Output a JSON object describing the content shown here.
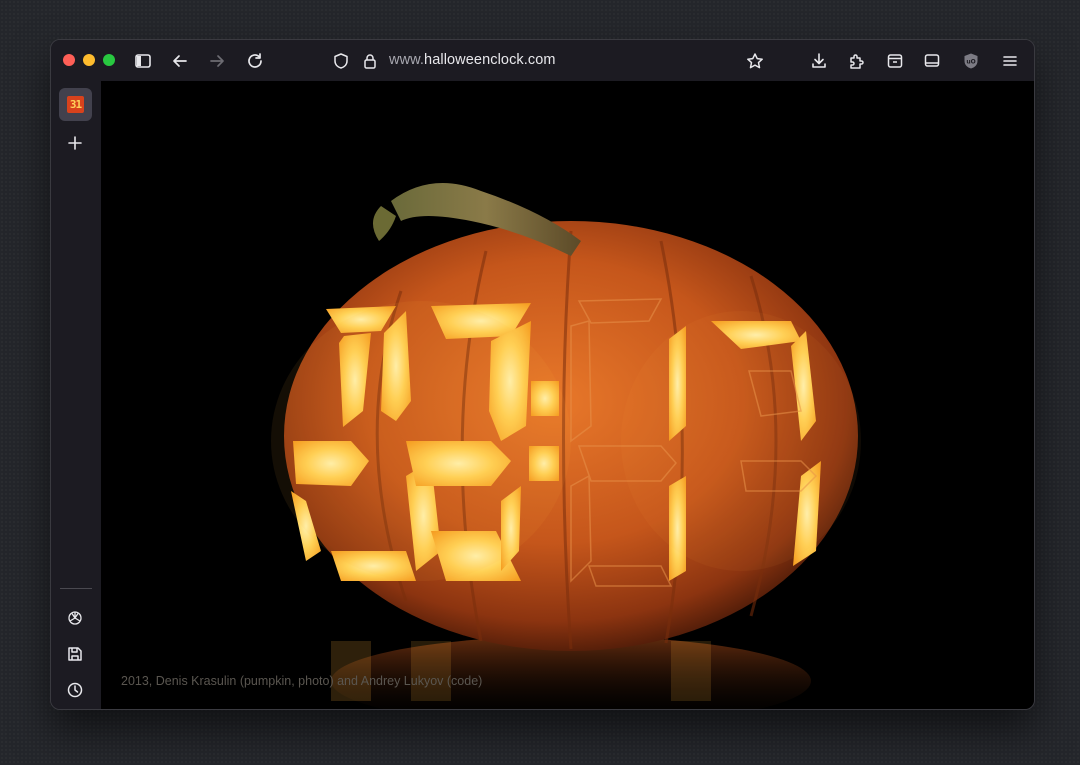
{
  "browser": {
    "url_prefix": "www.",
    "url_host": "halloweenclock.com",
    "tab_favicon_text": "31",
    "icons": {
      "sidebar_toggle": "sidebar-toggle-icon",
      "back": "arrow-left-icon",
      "forward": "arrow-right-icon",
      "reload": "reload-icon",
      "shield": "shield-icon",
      "lock": "lock-icon",
      "bookmark": "star-icon",
      "downloads": "download-icon",
      "extensions": "puzzle-icon",
      "pocket": "archive-icon",
      "view": "laptop-icon",
      "ublock": "ublock-icon",
      "menu": "hamburger-menu-icon"
    }
  },
  "sidebar": {
    "items": [
      {
        "name": "new-tab",
        "icon": "plus-icon"
      },
      {
        "name": "chatbot",
        "icon": "openai-icon"
      },
      {
        "name": "bookmarks",
        "icon": "save-icon"
      },
      {
        "name": "history",
        "icon": "clock-icon"
      },
      {
        "name": "settings",
        "icon": "gear-icon"
      }
    ]
  },
  "page": {
    "credit": "2013, Denis Krasulin (pumpkin, photo) and Andrey Lukyov (code)"
  },
  "colors": {
    "accent_glow": "#ffd256",
    "pumpkin": "#c5561b",
    "traffic_red": "#fe5f57",
    "traffic_yellow": "#febc2e",
    "traffic_green": "#28c840"
  }
}
